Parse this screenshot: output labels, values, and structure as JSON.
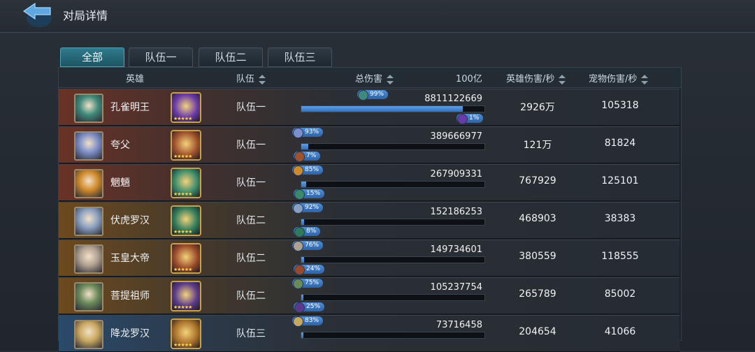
{
  "title": "对局详情",
  "tabs": [
    "全部",
    "队伍一",
    "队伍二",
    "队伍三"
  ],
  "active_tab": 0,
  "columns": {
    "hero": "英雄",
    "team": "队伍",
    "total": "总伤害",
    "scale": "100亿",
    "hero_dps": "英雄伤害/秒",
    "pet_dps": "宠物伤害/秒"
  },
  "rows": [
    {
      "name": "孔雀明王",
      "team": "队伍一",
      "total": "8811122669",
      "hero_pct": "99%",
      "pet_pct": "1%",
      "fill": 0.88,
      "dps": "2926万",
      "pet_dps": "105318",
      "tier": "t1",
      "avatar_color": "#3f8a7a",
      "pet_color": "#6a3aa8"
    },
    {
      "name": "夸父",
      "team": "队伍一",
      "total": "389666977",
      "hero_pct": "93%",
      "pet_pct": "7%",
      "fill": 0.039,
      "dps": "121万",
      "pet_dps": "81824",
      "tier": "t1",
      "avatar_color": "#7d8fc8",
      "pet_color": "#a0522d"
    },
    {
      "name": "魍魎",
      "team": "队伍一",
      "total": "267909331",
      "hero_pct": "85%",
      "pet_pct": "15%",
      "fill": 0.027,
      "dps": "767929",
      "pet_dps": "125101",
      "tier": "t1",
      "avatar_color": "#d08a2a",
      "pet_color": "#3a8a6a"
    },
    {
      "name": "伏虎罗汉",
      "team": "队伍二",
      "total": "152186253",
      "hero_pct": "92%",
      "pet_pct": "8%",
      "fill": 0.015,
      "dps": "468903",
      "pet_dps": "38383",
      "tier": "t2",
      "avatar_color": "#8aa0c0",
      "pet_color": "#2f7a5a"
    },
    {
      "name": "玉皇大帝",
      "team": "队伍二",
      "total": "149734601",
      "hero_pct": "76%",
      "pet_pct": "24%",
      "fill": 0.015,
      "dps": "380559",
      "pet_dps": "118555",
      "tier": "t2",
      "avatar_color": "#b0a090",
      "pet_color": "#9a4a2a"
    },
    {
      "name": "菩提祖师",
      "team": "队伍二",
      "total": "105237754",
      "hero_pct": "75%",
      "pet_pct": "25%",
      "fill": 0.011,
      "dps": "265789",
      "pet_dps": "85002",
      "tier": "t2",
      "avatar_color": "#6a8a5a",
      "pet_color": "#5a3a8a"
    },
    {
      "name": "降龙罗汉",
      "team": "队伍三",
      "total": "73716458",
      "hero_pct": "83%",
      "pet_pct": "",
      "fill": 0.007,
      "dps": "204654",
      "pet_dps": "41066",
      "tier": "t3",
      "avatar_color": "#c8a860",
      "pet_color": "#a8702a"
    }
  ]
}
